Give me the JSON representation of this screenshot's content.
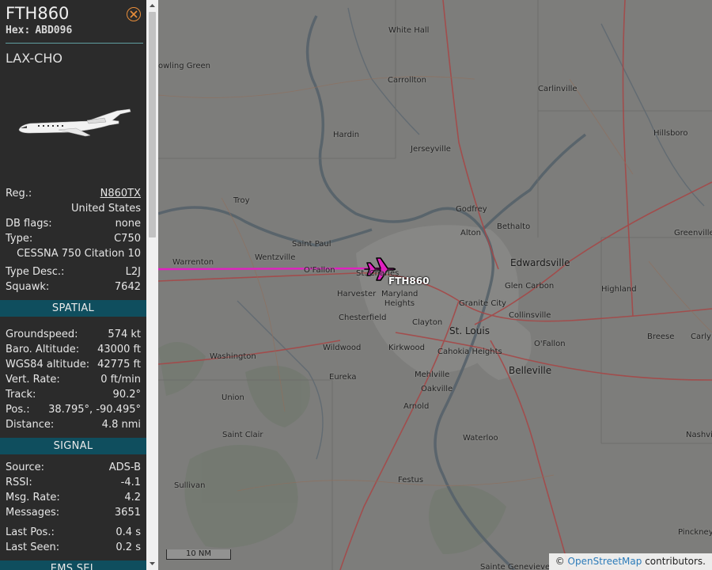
{
  "header": {
    "callsign": "FTH860",
    "hex_label": "Hex:",
    "hex_value": "ABD096",
    "route": "LAX-CHO"
  },
  "aircraft": {
    "reg_label": "Reg.:",
    "reg_value": "N860TX",
    "country": "United States",
    "dbflags_label": "DB flags:",
    "dbflags_value": "none",
    "type_label": "Type:",
    "type_value": "C750",
    "type_name": "CESSNA 750 Citation 10",
    "typedesc_label": "Type Desc.:",
    "typedesc_value": "L2J",
    "squawk_label": "Squawk:",
    "squawk_value": "7642"
  },
  "spatial": {
    "title": "SPATIAL",
    "groundspeed_label": "Groundspeed:",
    "groundspeed_value": "574 kt",
    "baro_label": "Baro. Altitude:",
    "baro_value": "43000 ft",
    "wgs_label": "WGS84 altitude:",
    "wgs_value": "42775 ft",
    "vert_label": "Vert. Rate:",
    "vert_value": "0 ft/min",
    "track_label": "Track:",
    "track_value": "90.2°",
    "pos_label": "Pos.:",
    "pos_value": "38.795°, -90.495°",
    "distance_label": "Distance:",
    "distance_value": "4.8 nmi"
  },
  "signal": {
    "title": "SIGNAL",
    "source_label": "Source:",
    "source_value": "ADS-B",
    "rssi_label": "RSSI:",
    "rssi_value": "-4.1",
    "msgrate_label": "Msg. Rate:",
    "msgrate_value": "4.2",
    "messages_label": "Messages:",
    "messages_value": "3651",
    "lastpos_label": "Last Pos.:",
    "lastpos_value": "0.4 s",
    "lastseen_label": "Last Seen:",
    "lastseen_value": "0.2 s"
  },
  "ems": {
    "title": "EMS SEL"
  },
  "map": {
    "aircraft_label": "FTH860",
    "track_color": "#e020c0",
    "scale_label": "10 NM",
    "attribution_prefix": "©",
    "attribution_link": "OpenStreetMap",
    "attribution_suffix": "contributors.",
    "places": [
      "White Hall",
      "owling Green",
      "Carrollton",
      "Carlinville",
      "Hardin",
      "Hillsboro",
      "Jerseyville",
      "Troy",
      "Godfrey",
      "Bethalto",
      "Alton",
      "Greenville",
      "Saint Paul",
      "Wentzville",
      "Edwardsville",
      "Warrenton",
      "O'Fallon",
      "St. Charles",
      "Maryland Heights",
      "Glen Carbon",
      "Highland",
      "Harvester",
      "Granite City",
      "Collinsville",
      "Chesterfield",
      "Clayton",
      "St. Louis",
      "Breese",
      "Carly",
      "Wildwood",
      "Kirkwood",
      "Cahokia Heights",
      "O'Fallon",
      "Washington",
      "Belleville",
      "Eureka",
      "Mehlville",
      "Union",
      "Oakville",
      "Arnold",
      "Saint Clair",
      "Waterloo",
      "Nashvi",
      "Sullivan",
      "Festus",
      "Pinckney",
      "Sainte Genevieve"
    ]
  }
}
